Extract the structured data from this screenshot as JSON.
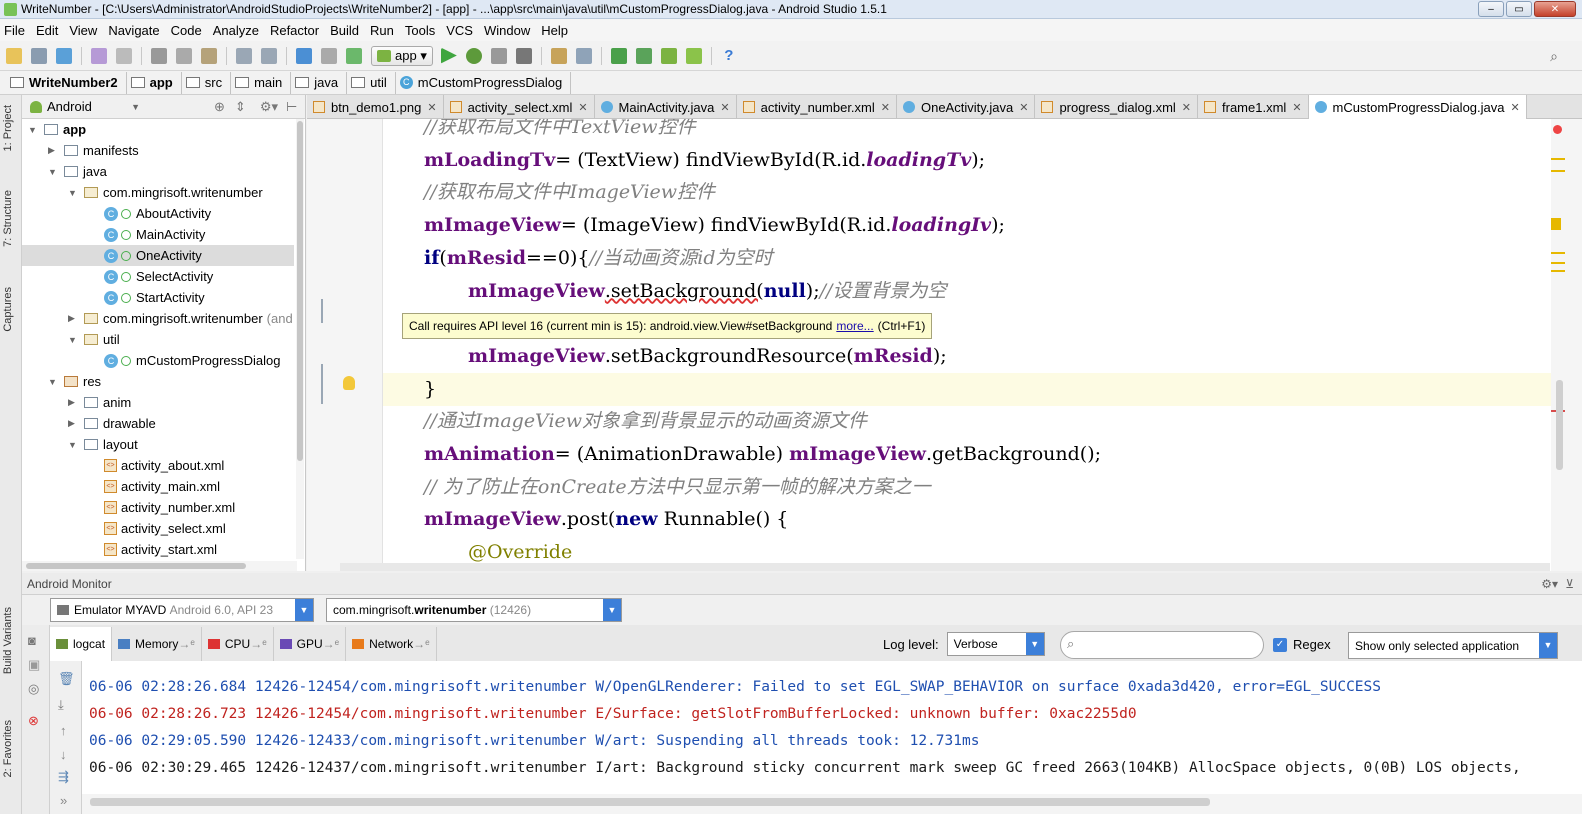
{
  "window": {
    "title": "WriteNumber - [C:\\Users\\Administrator\\AndroidStudioProjects\\WriteNumber2] - [app] - ...\\app\\src\\main\\java\\util\\mCustomProgressDialog.java - Android Studio 1.5.1"
  },
  "menu": [
    "File",
    "Edit",
    "View",
    "Navigate",
    "Code",
    "Analyze",
    "Refactor",
    "Build",
    "Run",
    "Tools",
    "VCS",
    "Window",
    "Help"
  ],
  "toolbar": {
    "run_config": "app"
  },
  "breadcrumb": [
    "WriteNumber2",
    "app",
    "src",
    "main",
    "java",
    "util",
    "mCustomProgressDialog"
  ],
  "project_panel": {
    "view": "Android"
  },
  "left_tabs": [
    "1: Project",
    "7: Structure",
    "Captures",
    "Build Variants",
    "2: Favorites"
  ],
  "tree": [
    {
      "label": "app",
      "depth": 0,
      "kind": "app",
      "arrow": "▼",
      "bold": true
    },
    {
      "label": "manifests",
      "depth": 1,
      "kind": "folder",
      "arrow": "▶"
    },
    {
      "label": "java",
      "depth": 1,
      "kind": "folder",
      "arrow": "▼"
    },
    {
      "label": "com.mingrisoft.writenumber",
      "depth": 2,
      "kind": "pkg",
      "arrow": "▼"
    },
    {
      "label": "AboutActivity",
      "depth": 3,
      "kind": "class"
    },
    {
      "label": "MainActivity",
      "depth": 3,
      "kind": "class"
    },
    {
      "label": "OneActivity",
      "depth": 3,
      "kind": "class",
      "selected": true
    },
    {
      "label": "SelectActivity",
      "depth": 3,
      "kind": "class"
    },
    {
      "label": "StartActivity",
      "depth": 3,
      "kind": "class"
    },
    {
      "label": "com.mingrisoft.writenumber",
      "suffix": "(and",
      "depth": 2,
      "kind": "pkg",
      "arrow": "▶"
    },
    {
      "label": "util",
      "depth": 2,
      "kind": "pkg",
      "arrow": "▼"
    },
    {
      "label": "mCustomProgressDialog",
      "depth": 3,
      "kind": "class"
    },
    {
      "label": "res",
      "depth": 1,
      "kind": "res",
      "arrow": "▼"
    },
    {
      "label": "anim",
      "depth": 2,
      "kind": "folder",
      "arrow": "▶"
    },
    {
      "label": "drawable",
      "depth": 2,
      "kind": "folder",
      "arrow": "▶"
    },
    {
      "label": "layout",
      "depth": 2,
      "kind": "folder",
      "arrow": "▼"
    },
    {
      "label": "activity_about.xml",
      "depth": 3,
      "kind": "xml"
    },
    {
      "label": "activity_main.xml",
      "depth": 3,
      "kind": "xml"
    },
    {
      "label": "activity_number.xml",
      "depth": 3,
      "kind": "xml"
    },
    {
      "label": "activity_select.xml",
      "depth": 3,
      "kind": "xml"
    },
    {
      "label": "activity_start.xml",
      "depth": 3,
      "kind": "xml"
    }
  ],
  "editor_tabs": [
    {
      "label": "btn_demo1.png",
      "kind": "img"
    },
    {
      "label": "activity_select.xml",
      "kind": "xml"
    },
    {
      "label": "MainActivity.java",
      "kind": "java"
    },
    {
      "label": "activity_number.xml",
      "kind": "xml"
    },
    {
      "label": "OneActivity.java",
      "kind": "java"
    },
    {
      "label": "progress_dialog.xml",
      "kind": "xml"
    },
    {
      "label": "frame1.xml",
      "kind": "xml"
    },
    {
      "label": "mCustomProgressDialog.java",
      "kind": "java",
      "active": true
    }
  ],
  "code": [
    {
      "indent": 1,
      "tokens": [
        [
          "cm",
          "//获取布局文件中TextView控件"
        ]
      ]
    },
    {
      "indent": 1,
      "tokens": [
        [
          "fld",
          "mLoadingTv"
        ],
        [
          "",
          "= (TextView) findViewById(R.id."
        ],
        [
          "idc",
          "loadingTv"
        ],
        [
          "",
          ");"
        ]
      ]
    },
    {
      "indent": 1,
      "tokens": [
        [
          "cm",
          "//获取布局文件中ImageView控件"
        ]
      ]
    },
    {
      "indent": 1,
      "tokens": [
        [
          "fld",
          "mImageView"
        ],
        [
          "",
          "= (ImageView) findViewById(R.id."
        ],
        [
          "idc",
          "loadingIv"
        ],
        [
          "",
          ");"
        ]
      ]
    },
    {
      "indent": 1,
      "tokens": [
        [
          "kw",
          "if"
        ],
        [
          "",
          "("
        ],
        [
          "fld",
          "mResid"
        ],
        [
          "",
          "==0){"
        ],
        [
          "cm",
          "//当动画资源id为空时"
        ]
      ]
    },
    {
      "indent": 2,
      "tokens": [
        [
          "fld",
          "mImageView"
        ],
        [
          "",
          ".setBackground("
        ],
        [
          "kw",
          "null"
        ],
        [
          "",
          ");"
        ],
        [
          "cm",
          "//设置背景为空"
        ]
      ]
    },
    {
      "indent": 2,
      "tokens": [
        [
          "",
          "} "
        ]
      ],
      "hidden": true
    },
    {
      "indent": 2,
      "tokens": [
        [
          "fld",
          "mImageView"
        ],
        [
          "",
          ".setBackgroundResource("
        ],
        [
          "fld",
          "mResid"
        ],
        [
          "",
          ");"
        ]
      ]
    },
    {
      "indent": 1,
      "tokens": [
        [
          "",
          "}"
        ]
      ],
      "highlight": true
    },
    {
      "indent": 1,
      "tokens": [
        [
          "cm",
          "//通过ImageView对象拿到背景显示的动画资源文件"
        ]
      ]
    },
    {
      "indent": 1,
      "tokens": [
        [
          "fld",
          "mAnimation"
        ],
        [
          "",
          "= (AnimationDrawable) "
        ],
        [
          "fld",
          "mImageView"
        ],
        [
          "",
          ".getBackground();"
        ]
      ]
    },
    {
      "indent": 1,
      "tokens": [
        [
          "cm",
          "// 为了防止在onCreate方法中只显示第一帧的解决方案之一"
        ]
      ]
    },
    {
      "indent": 1,
      "tokens": [
        [
          "fld",
          "mImageView"
        ],
        [
          "",
          ".post("
        ],
        [
          "kw",
          "new"
        ],
        [
          "",
          " Runnable() {"
        ]
      ]
    },
    {
      "indent": 2,
      "tokens": [
        [
          "ann",
          "@Override"
        ]
      ]
    }
  ],
  "tooltip": {
    "text": "Call requires API level 16 (current min is 15): android.view.View#setBackground",
    "link": "more...",
    "shortcut": "(Ctrl+F1)"
  },
  "monitor": {
    "title": "Android Monitor",
    "device": "Emulator MYAVD",
    "device_detail": "Android 6.0, API 23",
    "process_prefix": "com.mingrisoft.",
    "process_bold": "writenumber",
    "process_pid": "(12426)",
    "tabs": [
      {
        "label": "logcat",
        "active": true
      },
      {
        "label": "Memory"
      },
      {
        "label": "CPU"
      },
      {
        "label": "GPU"
      },
      {
        "label": "Network"
      }
    ],
    "log_level_label": "Log level:",
    "log_level": "Verbose",
    "regex_label": "Regex",
    "filter": "Show only selected application",
    "lines": [
      {
        "level": "W",
        "text": "06-06 02:28:26.684 12426-12454/com.mingrisoft.writenumber W/OpenGLRenderer: Failed to set EGL_SWAP_BEHAVIOR on surface 0xada3d420, error=EGL_SUCCESS"
      },
      {
        "level": "E",
        "text": "06-06 02:28:26.723 12426-12454/com.mingrisoft.writenumber E/Surface: getSlotFromBufferLocked: unknown buffer: 0xac2255d0"
      },
      {
        "level": "W",
        "text": "06-06 02:29:05.590 12426-12433/com.mingrisoft.writenumber W/art: Suspending all threads took: 12.731ms"
      },
      {
        "level": "I",
        "text": "06-06 02:30:29.465 12426-12437/com.mingrisoft.writenumber I/art: Background sticky concurrent mark sweep GC freed 2663(104KB) AllocSpace objects, 0(0B) LOS objects,"
      }
    ]
  }
}
